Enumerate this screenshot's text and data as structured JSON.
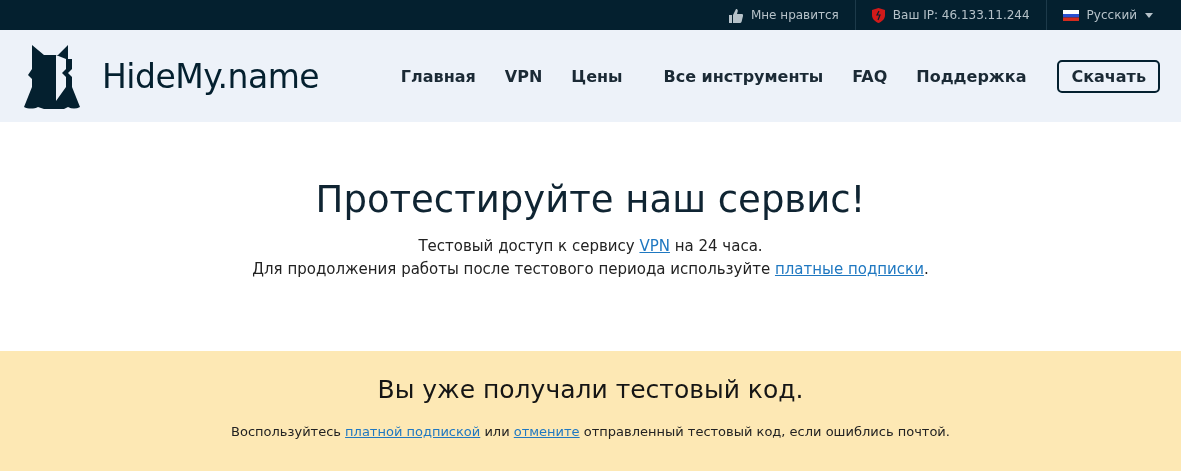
{
  "topbar": {
    "like": "Мне нравится",
    "ip": "Ваш IP: 46.133.11.244",
    "language": "Русский"
  },
  "header": {
    "logo": "HideMy.name",
    "nav": [
      {
        "label": "Главная"
      },
      {
        "label": "VPN"
      },
      {
        "label": "Цены"
      },
      {
        "label": "Все инструменты"
      },
      {
        "label": "FAQ"
      },
      {
        "label": "Поддержка"
      }
    ],
    "download": "Скачать"
  },
  "hero": {
    "title": "Протестируйте наш сервис!",
    "lines": [
      [
        {
          "kind": "text",
          "text": "Тестовый доступ к сервису "
        },
        {
          "kind": "link",
          "text": "VPN"
        },
        {
          "kind": "text",
          "text": " на 24 часа."
        }
      ],
      [
        {
          "kind": "text",
          "text": "Для продолжения работы после тестового периода используйте "
        },
        {
          "kind": "link",
          "text": "платные подписки"
        },
        {
          "kind": "text",
          "text": "."
        }
      ]
    ]
  },
  "notice": {
    "title": "Вы уже получали тестовый код.",
    "line": [
      {
        "kind": "text",
        "text": "Воспользуйтесь "
      },
      {
        "kind": "link",
        "text": "платной подпиской"
      },
      {
        "kind": "text",
        "text": " или "
      },
      {
        "kind": "link",
        "text": "отмените"
      },
      {
        "kind": "text",
        "text": " отправленный тестовый код, если ошиблись почтой."
      }
    ]
  }
}
